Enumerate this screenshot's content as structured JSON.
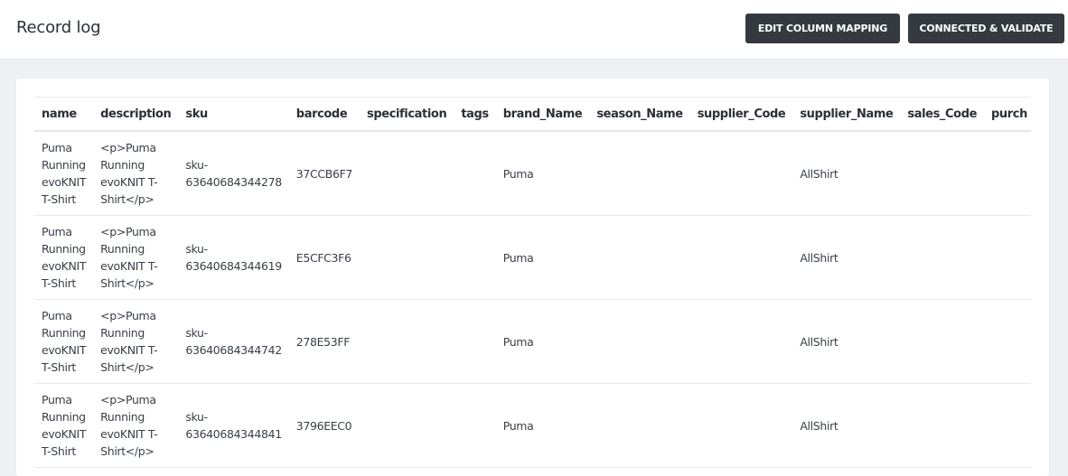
{
  "header": {
    "title": "Record log",
    "edit_mapping_label": "EDIT COLUMN MAPPING",
    "connect_validate_label": "CONNECTED & VALIDATE"
  },
  "table": {
    "columns": [
      "name",
      "description",
      "sku",
      "barcode",
      "specification",
      "tags",
      "brand_Name",
      "season_Name",
      "supplier_Code",
      "supplier_Name",
      "sales_Code",
      "purch"
    ],
    "rows": [
      {
        "name": "Puma Running evoKNIT T-Shirt",
        "description": "<p>Puma Running evoKNIT T-Shirt</p>",
        "sku": "sku-63640684344278",
        "barcode": "37CCB6F7",
        "specification": "",
        "tags": "",
        "brand_Name": "Puma",
        "season_Name": "",
        "supplier_Code": "",
        "supplier_Name": "AllShirt",
        "sales_Code": "",
        "purch": ""
      },
      {
        "name": "Puma Running evoKNIT T-Shirt",
        "description": "<p>Puma Running evoKNIT T-Shirt</p>",
        "sku": "sku-63640684344619",
        "barcode": "E5CFC3F6",
        "specification": "",
        "tags": "",
        "brand_Name": "Puma",
        "season_Name": "",
        "supplier_Code": "",
        "supplier_Name": "AllShirt",
        "sales_Code": "",
        "purch": ""
      },
      {
        "name": "Puma Running evoKNIT T-Shirt",
        "description": "<p>Puma Running evoKNIT T-Shirt</p>",
        "sku": "sku-63640684344742",
        "barcode": "278E53FF",
        "specification": "",
        "tags": "",
        "brand_Name": "Puma",
        "season_Name": "",
        "supplier_Code": "",
        "supplier_Name": "AllShirt",
        "sales_Code": "",
        "purch": ""
      },
      {
        "name": "Puma Running evoKNIT T-Shirt",
        "description": "<p>Puma Running evoKNIT T-Shirt</p>",
        "sku": "sku-63640684344841",
        "barcode": "3796EEC0",
        "specification": "",
        "tags": "",
        "brand_Name": "Puma",
        "season_Name": "",
        "supplier_Code": "",
        "supplier_Name": "AllShirt",
        "sales_Code": "",
        "purch": ""
      }
    ]
  },
  "colors": {
    "button_bg": "#343a40",
    "page_bg": "#eef0f4"
  }
}
